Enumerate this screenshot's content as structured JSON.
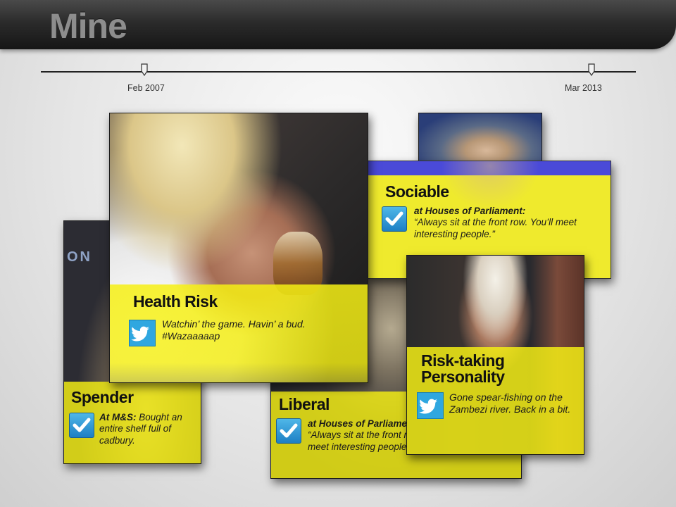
{
  "header": {
    "title": "Mine"
  },
  "timeline": {
    "start_label": "Feb 2007",
    "end_label": "Mar 2013"
  },
  "cards": {
    "spender": {
      "title": "Spender",
      "icon": "foursquare-check-icon",
      "venue": "At M&S:",
      "text": " Bought an entire shelf full of cadbury."
    },
    "liberal": {
      "title": "Liberal",
      "icon": "foursquare-check-icon",
      "venue": "at Houses of Parliament:",
      "text": "“Always sit at the front row. You’ll meet interesting people.”"
    },
    "health_risk": {
      "title": "Health Risk",
      "icon": "twitter-bird-icon",
      "text": "Watchin’ the game. Havin’ a bud. #Wazaaaaap"
    },
    "sociable": {
      "title": "Sociable",
      "icon": "foursquare-check-icon",
      "venue": "at Houses of Parliament:",
      "text": "“Always sit at the front row. You’ll meet interesting people.”"
    },
    "risk_taking": {
      "title_line1": "Risk-taking",
      "title_line2": "Personality",
      "icon": "twitter-bird-icon",
      "text": "Gone spear-fishing on the Zambezi river. Back in a bit."
    }
  },
  "colors": {
    "highlight_yellow": "#f6f014",
    "twitter_blue": "#2fa7e0",
    "header_dark": "#222222"
  }
}
